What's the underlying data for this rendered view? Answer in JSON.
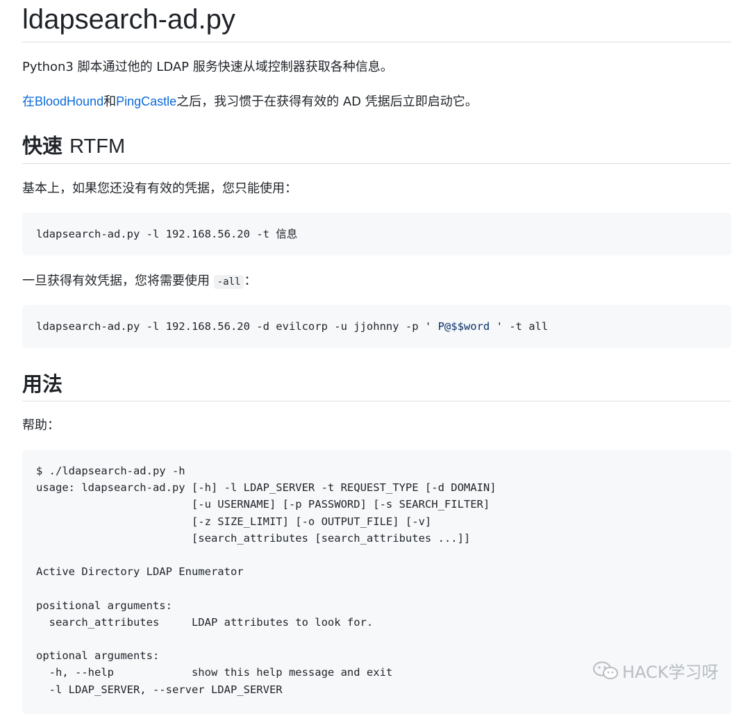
{
  "title": "ldapsearch-ad.py",
  "intro": "Python3 脚本通过他的 LDAP 服务快速从域控制器获取各种信息。",
  "links_para": {
    "prefix": "在",
    "link1": "BloodHound",
    "mid": "和",
    "link2": "PingCastle",
    "suffix": "之后，我习惯于在获得有效的 AD 凭据后立即启动它。"
  },
  "section1": {
    "heading_cn": "快速",
    "heading_en": "RTFM",
    "para1": "基本上，如果您还没有有效的凭据，您只能使用：",
    "code1": "ldapsearch-ad.py -l 192.168.56.20 -t 信息",
    "para2_prefix": "一旦获得有效凭据，您将需要使用",
    "para2_code": "-all",
    "para2_suffix": "：",
    "code2_pre": "ldapsearch-ad.py -l 192.168.56.20 -d evilcorp -u jjohnny -p ' ",
    "code2_str": "P@$$word",
    "code2_post": " ' -t all"
  },
  "section2": {
    "heading": "用法",
    "para": "帮助：",
    "help_lines": [
      "$ ./ldapsearch-ad.py -h",
      "usage: ldapsearch-ad.py [-h] -l LDAP_SERVER -t REQUEST_TYPE [-d DOMAIN]",
      "                        [-u USERNAME] [-p PASSWORD] [-s SEARCH_FILTER]",
      "                        [-z SIZE_LIMIT] [-o OUTPUT_FILE] [-v]",
      "                        [search_attributes [search_attributes ...]]",
      "",
      "Active Directory LDAP Enumerator",
      "",
      "positional arguments:",
      "  search_attributes     LDAP attributes to look for.",
      "",
      "optional arguments:",
      "  -h, --help            show this help message and exit",
      "  -l LDAP_SERVER, --server LDAP_SERVER"
    ]
  },
  "watermark": "HACK学习呀"
}
